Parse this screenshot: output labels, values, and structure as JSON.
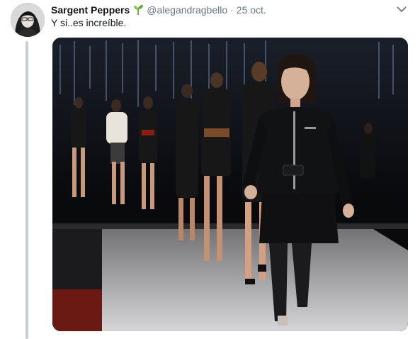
{
  "tweet": {
    "author_name": "Sargent Peppers",
    "handle": "@alegandragbello",
    "separator": "·",
    "date": "25 oct.",
    "text": "Y si..es increíble.",
    "name_emoji_icon": "seedling-icon",
    "more_icon": "chevron-down-icon"
  },
  "colors": {
    "primary_text": "#14171a",
    "secondary_text": "#657786",
    "thread_line": "#c4cfd6",
    "seedling_green": "#5ca82d"
  }
}
